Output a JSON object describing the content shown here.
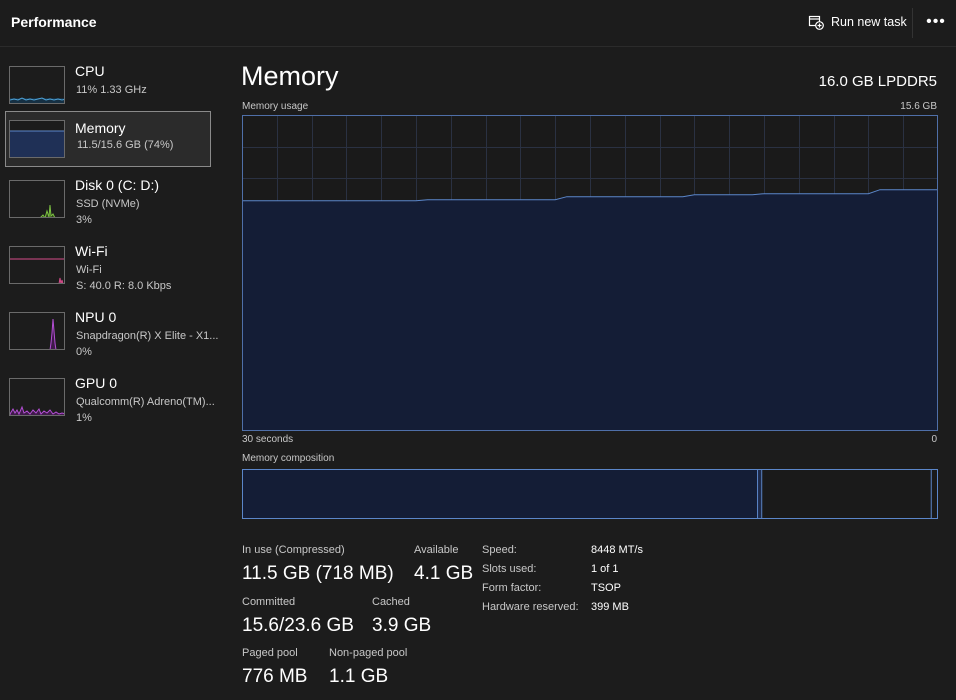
{
  "header": {
    "title": "Performance",
    "run_task_label": "Run new task",
    "more_label": "•••"
  },
  "sidebar": {
    "items": [
      {
        "title": "CPU",
        "sub1": "11%  1.33 GHz",
        "sub2": "",
        "color": "#4fa3d8"
      },
      {
        "title": "Memory",
        "sub1": "11.5/15.6 GB (74%)",
        "sub2": "",
        "color": "#5b86c9"
      },
      {
        "title": "Disk 0 (C: D:)",
        "sub1": "SSD (NVMe)",
        "sub2": "3%",
        "color": "#7cc241"
      },
      {
        "title": "Wi-Fi",
        "sub1": "Wi-Fi",
        "sub2": "S: 40.0  R: 8.0 Kbps",
        "color": "#d64b8a"
      },
      {
        "title": "NPU 0",
        "sub1": "Snapdragon(R) X Elite - X1...",
        "sub2": "0%",
        "color": "#b54fd6"
      },
      {
        "title": "GPU 0",
        "sub1": "Qualcomm(R) Adreno(TM)...",
        "sub2": "1%",
        "color": "#b54fd6"
      }
    ]
  },
  "main": {
    "title": "Memory",
    "mem_type": "16.0 GB LPDDR5",
    "usage_label": "Memory usage",
    "usage_max": "15.6 GB",
    "axis_left": "30 seconds",
    "axis_right": "0",
    "composition_label": "Memory composition",
    "usage_fraction": 0.735,
    "composition": {
      "in_use_fraction": 0.74,
      "modified_fraction": 0.006,
      "standby_fraction": 0.245
    }
  },
  "stats": {
    "in_use_label": "In use (Compressed)",
    "in_use_value": "11.5 GB (718 MB)",
    "available_label": "Available",
    "available_value": "4.1 GB",
    "committed_label": "Committed",
    "committed_value": "15.6/23.6 GB",
    "cached_label": "Cached",
    "cached_value": "3.9 GB",
    "paged_label": "Paged pool",
    "paged_value": "776 MB",
    "nonpaged_label": "Non-paged pool",
    "nonpaged_value": "1.1 GB"
  },
  "specs": [
    {
      "label": "Speed:",
      "value": "8448 MT/s"
    },
    {
      "label": "Slots used:",
      "value": "1 of 1"
    },
    {
      "label": "Form factor:",
      "value": "TSOP"
    },
    {
      "label": "Hardware reserved:",
      "value": "399 MB"
    }
  ],
  "colors": {
    "accent": "#5b86c9",
    "graph_fill": "#141d36",
    "grid": "#2a3142"
  }
}
